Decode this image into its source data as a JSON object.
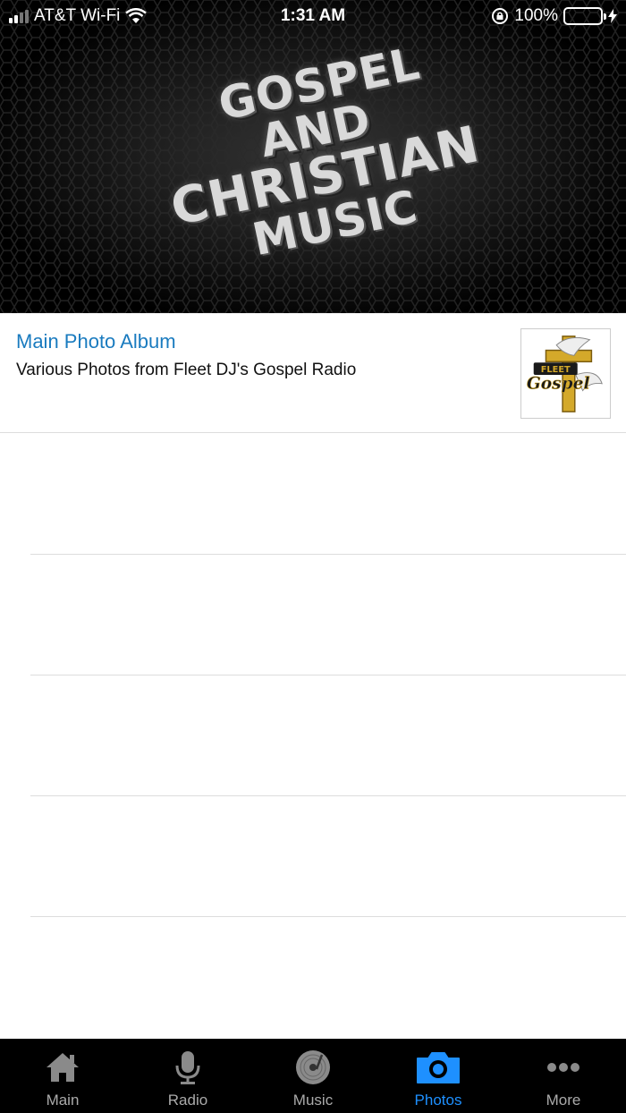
{
  "status_bar": {
    "carrier": "AT&T Wi-Fi",
    "time": "1:31 AM",
    "battery": "100%"
  },
  "banner": {
    "lines": [
      "GOSPEL",
      "AND",
      "CHRISTIAN",
      "MUSIC"
    ]
  },
  "albums": [
    {
      "title": "Main Photo Album",
      "subtitle": "Various Photos from Fleet DJ's Gospel Radio",
      "thumb_logo": "FLEET Gospel"
    }
  ],
  "tabs": [
    {
      "label": "Main",
      "icon": "home-icon",
      "active": false
    },
    {
      "label": "Radio",
      "icon": "microphone-icon",
      "active": false
    },
    {
      "label": "Music",
      "icon": "vinyl-record-icon",
      "active": false
    },
    {
      "label": "Photos",
      "icon": "camera-icon",
      "active": true
    },
    {
      "label": "More",
      "icon": "more-dots-icon",
      "active": false
    }
  ],
  "colors": {
    "accent": "#1e90ff",
    "album_title": "#1a7bbf",
    "tab_inactive": "#aaaaaa"
  }
}
